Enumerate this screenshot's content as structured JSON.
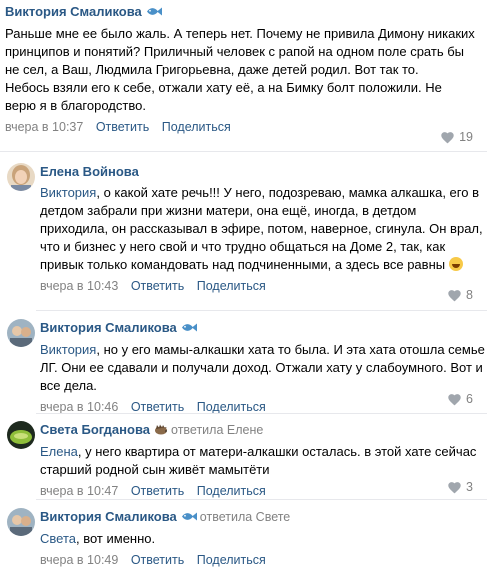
{
  "comments": [
    {
      "author": "Виктория Смаликова",
      "has_fish": true,
      "replied_to": "",
      "mention": "",
      "text": "Раньше мне ее было жаль. А теперь нет. Почему не привила Димону никаких принципов и понятий? Приличный человек с рапой на одном поле срать бы не сел, а Ваш, Людмила Григорьевна, даже детей родил. Вот так то.\nНебось взяли его к себе, отжали хату её, а на Бимку болт положили. Не верю я в благородство.",
      "time": "вчера в 10:37",
      "reply": "Ответить",
      "share": "Поделиться",
      "likes": "19"
    },
    {
      "author": "Елена Войнова",
      "has_fish": false,
      "replied_to": "",
      "mention": "Виктория",
      "text": ", о какой хате речь!!! У него, подозреваю, мамка алкашка, его в детдом забрали при жизни матери, она ещё, иногда, в детдом приходила, он рассказывал в эфире, потом, наверное, сгинула. Он врал, что и бизнес у него свой и что трудно общаться на Доме 2, так, как привык только командовать над подчиненными, а здесь все равны",
      "time": "вчера в 10:43",
      "reply": "Ответить",
      "share": "Поделиться",
      "likes": "8"
    },
    {
      "author": "Виктория Смаликова",
      "has_fish": true,
      "replied_to": "",
      "mention": "Виктория",
      "text": ", но у его мамы-алкашки хата то была. И эта хата отошла семье ЛГ. Они ее сдавали и получали доход. Отжали хату у слабоумного. Вот и все дела.",
      "time": "вчера в 10:46",
      "reply": "Ответить",
      "share": "Поделиться",
      "likes": "6"
    },
    {
      "author": "Света Богданова",
      "has_fish": false,
      "replied_to": "ответила Елене",
      "mention": "Елена",
      "text": ", у него квартира от матери-алкашки осталась. в этой хате сейчас старший родной сын живёт мамытёти",
      "time": "вчера в 10:47",
      "reply": "Ответить",
      "share": "Поделиться",
      "likes": "3"
    },
    {
      "author": "Виктория Смаликова",
      "has_fish": true,
      "replied_to": "ответила Свете",
      "mention": "Света",
      "text": ", вот именно.",
      "time": "вчера в 10:49",
      "reply": "Ответить",
      "share": "Поделиться",
      "likes": ""
    }
  ],
  "colors": {
    "link": "#2a5885",
    "meta": "#828282",
    "divider": "#e7e8ec"
  }
}
